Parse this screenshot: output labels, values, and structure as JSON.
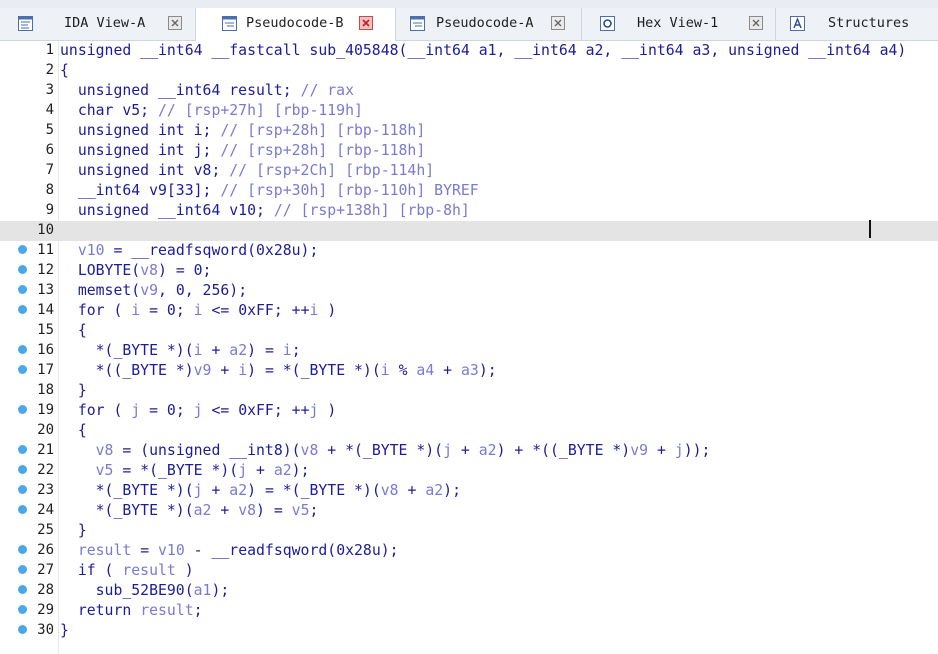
{
  "tabs": [
    {
      "label": "IDA View-A",
      "icon": "ida-view-icon",
      "active": false
    },
    {
      "label": "Pseudocode-B",
      "icon": "pseudocode-icon",
      "active": true
    },
    {
      "label": "Pseudocode-A",
      "icon": "pseudocode-icon",
      "active": false
    },
    {
      "label": "Hex View-1",
      "icon": "hex-view-icon",
      "active": false
    },
    {
      "label": "Structures",
      "icon": "structures-icon",
      "active": false
    }
  ],
  "lines": [
    {
      "n": "1",
      "bp": false,
      "segs": [
        [
          "k",
          "unsigned __int64 __fastcall sub_405848(__int64 a1, __int64 a2, __int64 a3, unsigned __int64 a4)"
        ]
      ]
    },
    {
      "n": "2",
      "bp": false,
      "segs": [
        [
          "k",
          "{"
        ]
      ]
    },
    {
      "n": "3",
      "bp": false,
      "segs": [
        [
          "k",
          "  unsigned __int64 result; "
        ],
        [
          "c",
          "// rax"
        ]
      ]
    },
    {
      "n": "4",
      "bp": false,
      "segs": [
        [
          "k",
          "  char v5; "
        ],
        [
          "c",
          "// [rsp+27h] [rbp-119h]"
        ]
      ]
    },
    {
      "n": "5",
      "bp": false,
      "segs": [
        [
          "k",
          "  unsigned int i; "
        ],
        [
          "c",
          "// [rsp+28h] [rbp-118h]"
        ]
      ]
    },
    {
      "n": "6",
      "bp": false,
      "segs": [
        [
          "k",
          "  unsigned int j; "
        ],
        [
          "c",
          "// [rsp+28h] [rbp-118h]"
        ]
      ]
    },
    {
      "n": "7",
      "bp": false,
      "segs": [
        [
          "k",
          "  unsigned int v8; "
        ],
        [
          "c",
          "// [rsp+2Ch] [rbp-114h]"
        ]
      ]
    },
    {
      "n": "8",
      "bp": false,
      "segs": [
        [
          "k",
          "  __int64 v9[33]; "
        ],
        [
          "c",
          "// [rsp+30h] [rbp-110h] BYREF"
        ]
      ]
    },
    {
      "n": "9",
      "bp": false,
      "segs": [
        [
          "k",
          "  unsigned __int64 v10; "
        ],
        [
          "c",
          "// [rsp+138h] [rbp-8h]"
        ]
      ]
    },
    {
      "n": "10",
      "bp": false,
      "hl": true,
      "segs": [
        [
          "k",
          ""
        ]
      ]
    },
    {
      "n": "11",
      "bp": true,
      "segs": [
        [
          "k",
          "  "
        ],
        [
          "c",
          "v10"
        ],
        [
          "k",
          " = __readfsqword(0x28u);"
        ]
      ]
    },
    {
      "n": "12",
      "bp": true,
      "segs": [
        [
          "k",
          "  LOBYTE("
        ],
        [
          "c",
          "v8"
        ],
        [
          "k",
          ") = 0;"
        ]
      ]
    },
    {
      "n": "13",
      "bp": true,
      "segs": [
        [
          "k",
          "  memset("
        ],
        [
          "c",
          "v9"
        ],
        [
          "k",
          ", 0, 256);"
        ]
      ]
    },
    {
      "n": "14",
      "bp": true,
      "segs": [
        [
          "k",
          "  for ( "
        ],
        [
          "c",
          "i"
        ],
        [
          "k",
          " = 0; "
        ],
        [
          "c",
          "i"
        ],
        [
          "k",
          " <= 0xFF; ++"
        ],
        [
          "c",
          "i"
        ],
        [
          "k",
          " )"
        ]
      ]
    },
    {
      "n": "15",
      "bp": false,
      "segs": [
        [
          "k",
          "  {"
        ]
      ]
    },
    {
      "n": "16",
      "bp": true,
      "segs": [
        [
          "k",
          "    *(_BYTE *)("
        ],
        [
          "c",
          "i"
        ],
        [
          "k",
          " + "
        ],
        [
          "c",
          "a2"
        ],
        [
          "k",
          ") = "
        ],
        [
          "c",
          "i"
        ],
        [
          "k",
          ";"
        ]
      ]
    },
    {
      "n": "17",
      "bp": true,
      "segs": [
        [
          "k",
          "    *((_BYTE *)"
        ],
        [
          "c",
          "v9"
        ],
        [
          "k",
          " + "
        ],
        [
          "c",
          "i"
        ],
        [
          "k",
          ") = *(_BYTE *)("
        ],
        [
          "c",
          "i"
        ],
        [
          "k",
          " % "
        ],
        [
          "c",
          "a4"
        ],
        [
          "k",
          " + "
        ],
        [
          "c",
          "a3"
        ],
        [
          "k",
          ");"
        ]
      ]
    },
    {
      "n": "18",
      "bp": false,
      "segs": [
        [
          "k",
          "  }"
        ]
      ]
    },
    {
      "n": "19",
      "bp": true,
      "segs": [
        [
          "k",
          "  for ( "
        ],
        [
          "c",
          "j"
        ],
        [
          "k",
          " = 0; "
        ],
        [
          "c",
          "j"
        ],
        [
          "k",
          " <= 0xFF; ++"
        ],
        [
          "c",
          "j"
        ],
        [
          "k",
          " )"
        ]
      ]
    },
    {
      "n": "20",
      "bp": false,
      "segs": [
        [
          "k",
          "  {"
        ]
      ]
    },
    {
      "n": "21",
      "bp": true,
      "segs": [
        [
          "k",
          "    "
        ],
        [
          "c",
          "v8"
        ],
        [
          "k",
          " = (unsigned __int8)("
        ],
        [
          "c",
          "v8"
        ],
        [
          "k",
          " + *(_BYTE *)("
        ],
        [
          "c",
          "j"
        ],
        [
          "k",
          " + "
        ],
        [
          "c",
          "a2"
        ],
        [
          "k",
          ") + *((_BYTE *)"
        ],
        [
          "c",
          "v9"
        ],
        [
          "k",
          " + "
        ],
        [
          "c",
          "j"
        ],
        [
          "k",
          "));"
        ]
      ]
    },
    {
      "n": "22",
      "bp": true,
      "segs": [
        [
          "k",
          "    "
        ],
        [
          "c",
          "v5"
        ],
        [
          "k",
          " = *(_BYTE *)("
        ],
        [
          "c",
          "j"
        ],
        [
          "k",
          " + "
        ],
        [
          "c",
          "a2"
        ],
        [
          "k",
          ");"
        ]
      ]
    },
    {
      "n": "23",
      "bp": true,
      "segs": [
        [
          "k",
          "    *(_BYTE *)("
        ],
        [
          "c",
          "j"
        ],
        [
          "k",
          " + "
        ],
        [
          "c",
          "a2"
        ],
        [
          "k",
          ") = *(_BYTE *)("
        ],
        [
          "c",
          "v8"
        ],
        [
          "k",
          " + "
        ],
        [
          "c",
          "a2"
        ],
        [
          "k",
          ");"
        ]
      ]
    },
    {
      "n": "24",
      "bp": true,
      "segs": [
        [
          "k",
          "    *(_BYTE *)("
        ],
        [
          "c",
          "a2"
        ],
        [
          "k",
          " + "
        ],
        [
          "c",
          "v8"
        ],
        [
          "k",
          ") = "
        ],
        [
          "c",
          "v5"
        ],
        [
          "k",
          ";"
        ]
      ]
    },
    {
      "n": "25",
      "bp": false,
      "segs": [
        [
          "k",
          "  }"
        ]
      ]
    },
    {
      "n": "26",
      "bp": true,
      "segs": [
        [
          "k",
          "  "
        ],
        [
          "c",
          "result"
        ],
        [
          "k",
          " = "
        ],
        [
          "c",
          "v10"
        ],
        [
          "k",
          " - __readfsqword(0x28u);"
        ]
      ]
    },
    {
      "n": "27",
      "bp": true,
      "segs": [
        [
          "k",
          "  if ( "
        ],
        [
          "c",
          "result"
        ],
        [
          "k",
          " )"
        ]
      ]
    },
    {
      "n": "28",
      "bp": true,
      "segs": [
        [
          "k",
          "    sub_52BE90("
        ],
        [
          "c",
          "a1"
        ],
        [
          "k",
          ");"
        ]
      ]
    },
    {
      "n": "29",
      "bp": true,
      "segs": [
        [
          "k",
          "  return "
        ],
        [
          "c",
          "result"
        ],
        [
          "k",
          ";"
        ]
      ]
    },
    {
      "n": "30",
      "bp": true,
      "segs": [
        [
          "k",
          "}"
        ]
      ]
    }
  ]
}
